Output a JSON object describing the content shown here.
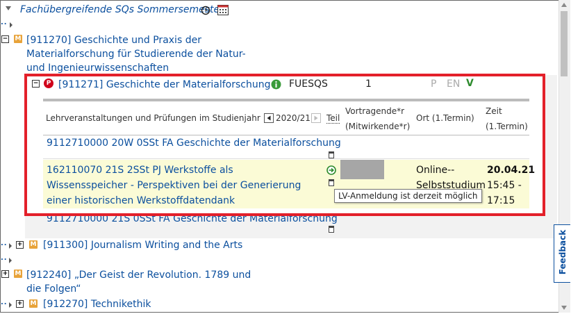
{
  "header": {
    "title": "Fachübergreifende SQs Sommersemester"
  },
  "tree": {
    "node_911270": "[911270] Geschichte und Praxis der Materialforschung für Studierende der Natur- und Ingenieurwissenschaften",
    "node_911271": {
      "label": "[911271] Geschichte der Materialforschung",
      "code": "FUESQS",
      "count": "1",
      "flag_p": "P",
      "flag_en": "EN",
      "flag_v": "V"
    },
    "node_911300": "[911300] Journalism Writing and the Arts",
    "node_912240": "[912240] „Der Geist der Revolution. 1789 und die Folgen“",
    "node_912270": "[912270] Technikethik"
  },
  "table": {
    "headers": {
      "course": "Lehrveranstaltungen und Prüfungen im Studienjahr",
      "year": "2020/21",
      "teil": "Teil",
      "vortragende": "Vortragende*r (Mitwirkende*r)",
      "ort": "Ort (1.Termin)",
      "zeit": "Zeit (1.Termin)"
    },
    "rows": [
      {
        "title": "9112710000 20W 0SSt FA Geschichte der Materialforschung"
      },
      {
        "title": "162110070 21S 2SSt PJ Werkstoffe als Wissensspeicher - Perspektiven bei der Generierung einer historischen Werkstoffdatendank",
        "ort": "Online-- Selbststudium",
        "date": "20.04.21",
        "time": "15:45 - 17:15"
      },
      {
        "title": "9112710000 21S 0SSt FA Geschichte der Materialforschung"
      }
    ],
    "tooltip": "LV-Anmeldung ist derzeit möglich"
  },
  "feedback": "Feedback",
  "colors": {
    "link": "#0b4f9e",
    "highlight": "#fbfbd6",
    "red_frame": "#e3202a",
    "badge_m": "#e8a33a",
    "green": "#2e8b2e"
  }
}
